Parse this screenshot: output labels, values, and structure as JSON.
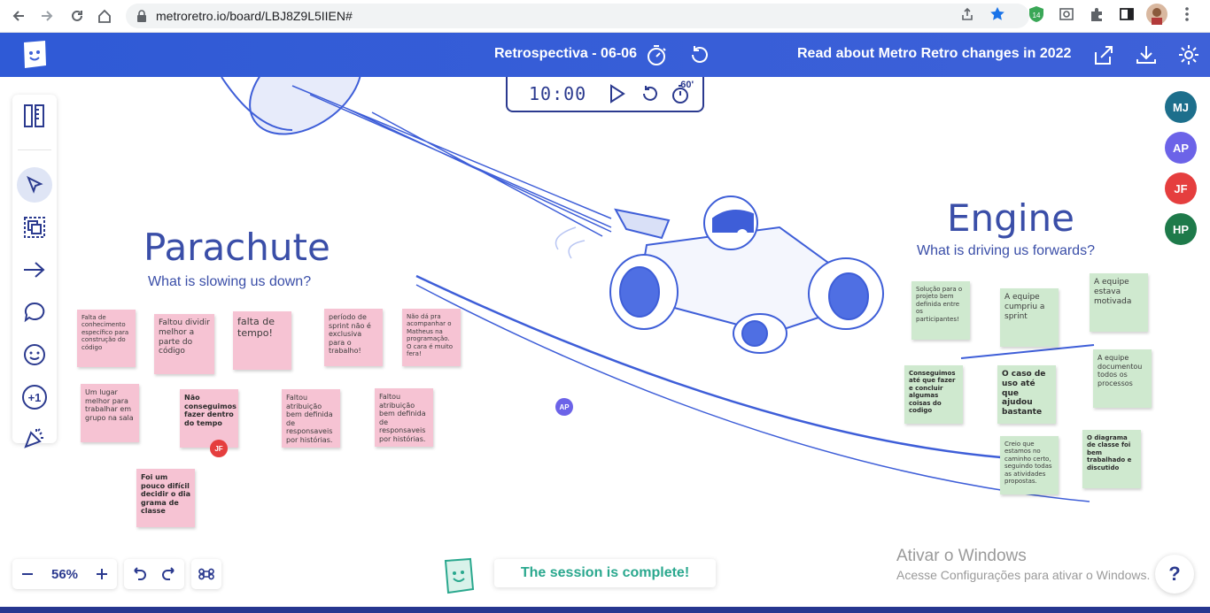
{
  "browser": {
    "url": "metroretro.io/board/LBJ8Z9L5IIEN#",
    "extension_badge": "14"
  },
  "header": {
    "board_title": "Retrospectiva - 06-06",
    "news_link": "Read about Metro Retro changes in 2022"
  },
  "timer": {
    "value": "10:00",
    "add_label": "60'"
  },
  "columns": {
    "parachute": {
      "title": "Parachute",
      "subtitle": "What is slowing us down?"
    },
    "engine": {
      "title": "Engine",
      "subtitle": "What is driving us forwards?"
    }
  },
  "parachute_notes": [
    {
      "text": "Falta de conhecimento específico para construção do código"
    },
    {
      "text": "Faltou dividir melhor a parte do código"
    },
    {
      "text": "falta de tempo!"
    },
    {
      "text": "período de sprint não é exclusiva para o trabalho!"
    },
    {
      "text": "Não dá pra acompanhar o Matheus na programação. O cara é muito fera!"
    },
    {
      "text": "Um lugar melhor para trabalhar em grupo na sala"
    },
    {
      "text": "Não conseguimos fazer dentro do tempo"
    },
    {
      "text": "Faltou atribuição bem definida de responsaveis por histórias."
    },
    {
      "text": "Faltou atribuição bem definida de responsaveis por histórias."
    },
    {
      "text": "Foi um pouco difícil decidir o dia grama de classe"
    }
  ],
  "engine_notes": [
    {
      "text": "Solução para o projeto bem definida entre os participantes!"
    },
    {
      "text": "A equipe cumpriu a sprint"
    },
    {
      "text": "A equipe estava motivada"
    },
    {
      "text": "A equipe documentou todos os processos"
    },
    {
      "text": "Conseguimos até que fazer e concluir algumas coisas do codigo"
    },
    {
      "text": "O caso de uso até que ajudou bastante"
    },
    {
      "text": "Creio que estamos no caminho certo, seguindo todas as atividades propostas."
    },
    {
      "text": "O diagrama de classe foi bem trabalhado e discutido"
    }
  ],
  "cursors": [
    {
      "initials": "AP",
      "color": "#6c63e8"
    },
    {
      "initials": "JF",
      "color": "#e53e3e"
    }
  ],
  "participants": [
    {
      "initials": "MJ",
      "color": "#1d6f8c"
    },
    {
      "initials": "AP",
      "color": "#6c63e8"
    },
    {
      "initials": "JF",
      "color": "#e53e3e"
    },
    {
      "initials": "HP",
      "color": "#1e7a4a"
    }
  ],
  "zoom": {
    "level": "56%"
  },
  "session": {
    "message": "The session is complete!"
  },
  "windows_watermark": {
    "title": "Ativar o Windows",
    "subtitle": "Acesse Configurações para ativar o Windows."
  },
  "help": {
    "label": "?"
  },
  "colors": {
    "accent": "#3e61d8",
    "note_pink": "#f6c3d3",
    "note_green": "#cfe9cf",
    "session_text": "#2aa88e"
  }
}
